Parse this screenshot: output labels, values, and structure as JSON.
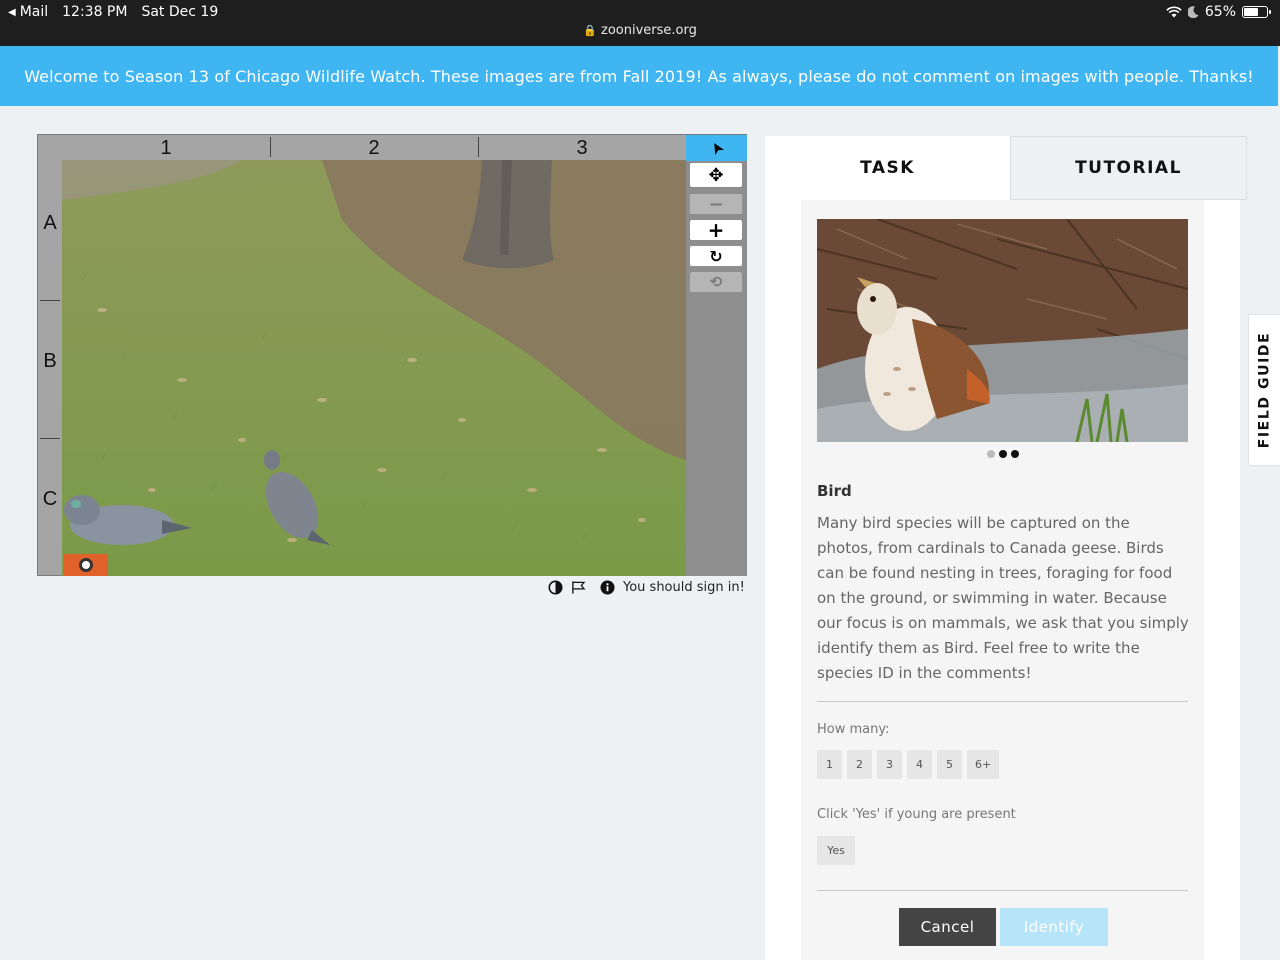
{
  "status_bar": {
    "back_app": "Mail",
    "time": "12:38 PM",
    "date": "Sat Dec 19",
    "battery": "65%",
    "battery_level": 0.65,
    "url": "zooniverse.org"
  },
  "banner": {
    "text": "Welcome to Season 13 of Chicago Wildlife Watch. These images are from Fall 2019! As always, please do not comment on images with people. Thanks!"
  },
  "viewer": {
    "columns": [
      "1",
      "2",
      "3"
    ],
    "rows": [
      "A",
      "B",
      "C"
    ],
    "tools": [
      {
        "name": "pointer-icon",
        "glyph": "➤"
      },
      {
        "name": "move-icon",
        "glyph": "✥"
      },
      {
        "name": "zoom-out-icon",
        "glyph": "−"
      },
      {
        "name": "zoom-in-icon",
        "glyph": "+"
      },
      {
        "name": "rotate-icon",
        "glyph": "↻"
      },
      {
        "name": "reset-icon",
        "glyph": "⟲"
      }
    ],
    "sign_in_text": "You should sign in!"
  },
  "panel": {
    "tabs": {
      "task": "TASK",
      "tutorial": "TUTORIAL"
    },
    "species": {
      "name": "Bird",
      "description": "Many bird species will be captured on the photos, from cardinals to Canada geese. Birds can be found nesting in trees, foraging for food on the ground, or swimming in water. Because our focus is on mammals, we ask that you simply identify them as Bird. Feel free to write the species ID in the comments!"
    },
    "how_many": {
      "label": "How many:",
      "options": [
        "1",
        "2",
        "3",
        "4",
        "5",
        "6+"
      ]
    },
    "young": {
      "label": "Click 'Yes' if young are present",
      "yes": "Yes"
    },
    "cancel": "Cancel",
    "identify": "Identify"
  },
  "field_guide": "FIELD GUIDE"
}
